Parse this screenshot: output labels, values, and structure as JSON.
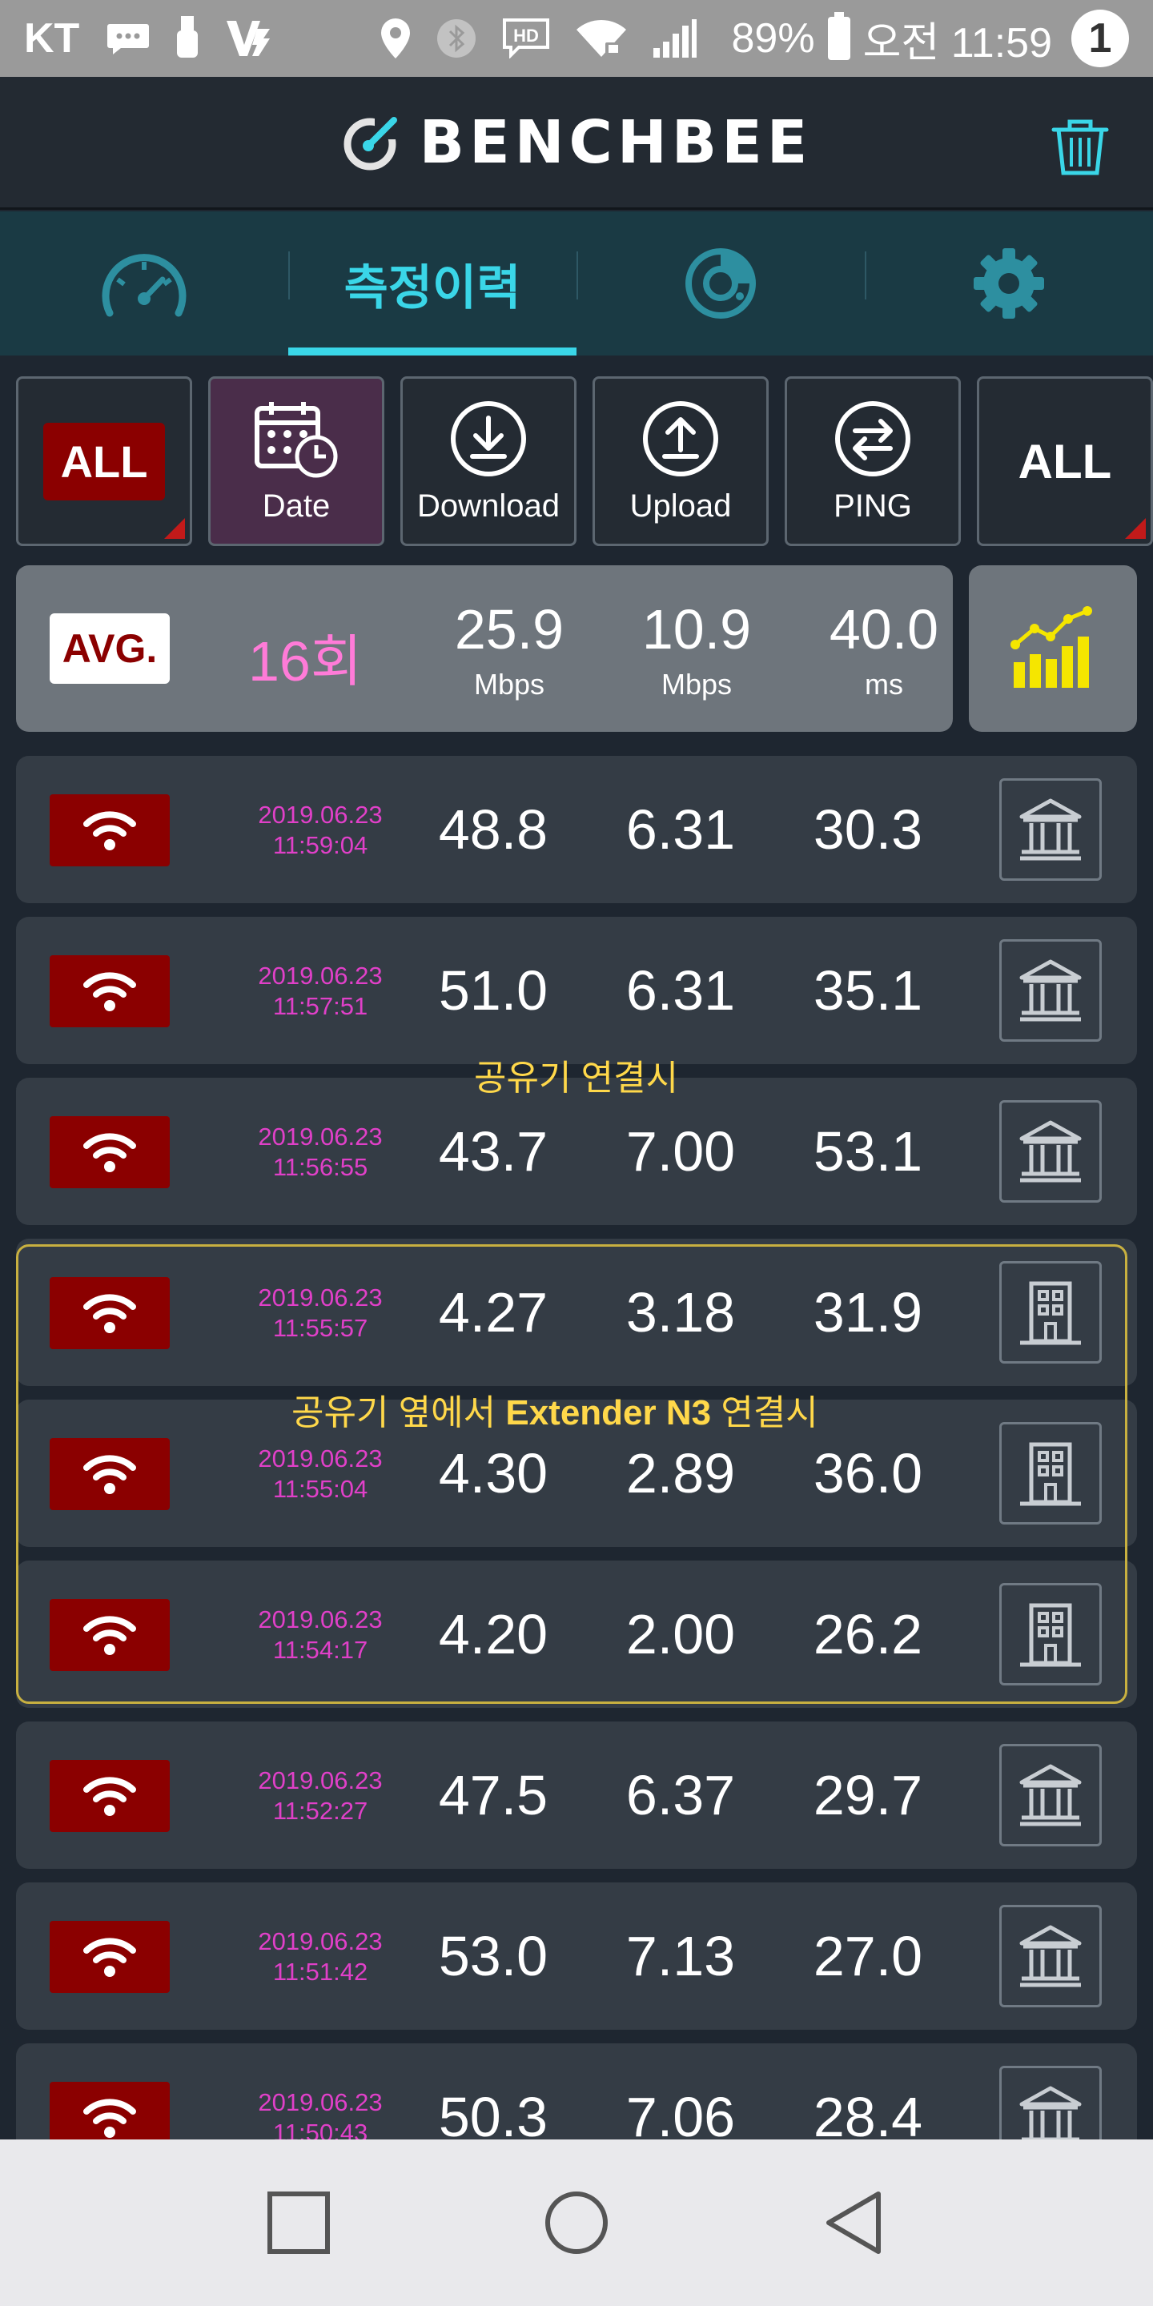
{
  "status_bar": {
    "carrier": "KT",
    "battery": "89%",
    "time": "오전 11:59",
    "notification_count": "1"
  },
  "header": {
    "app_name": "BENCHBEE"
  },
  "tabs": [
    {
      "label": "",
      "icon": "speedometer-icon"
    },
    {
      "label": "측정이력",
      "icon": ""
    },
    {
      "label": "",
      "icon": "chart-icon"
    },
    {
      "label": "",
      "icon": "gear-icon"
    }
  ],
  "filters": {
    "network": "ALL",
    "date": "Date",
    "download": "Download",
    "upload": "Upload",
    "ping": "PING",
    "server": "ALL"
  },
  "average": {
    "badge": "AVG.",
    "count": "16회",
    "download": "25.9",
    "download_unit": "Mbps",
    "upload": "10.9",
    "upload_unit": "Mbps",
    "ping": "40.0",
    "ping_unit": "ms"
  },
  "records": [
    {
      "date": "2019.06.23",
      "time": "11:59:04",
      "download": "48.8",
      "upload": "6.31",
      "ping": "30.3",
      "server_icon": "bank-icon"
    },
    {
      "date": "2019.06.23",
      "time": "11:57:51",
      "download": "51.0",
      "upload": "6.31",
      "ping": "35.1",
      "server_icon": "bank-icon"
    },
    {
      "date": "2019.06.23",
      "time": "11:56:55",
      "download": "43.7",
      "upload": "7.00",
      "ping": "53.1",
      "server_icon": "bank-icon"
    },
    {
      "date": "2019.06.23",
      "time": "11:55:57",
      "download": "4.27",
      "upload": "3.18",
      "ping": "31.9",
      "server_icon": "building-icon"
    },
    {
      "date": "2019.06.23",
      "time": "11:55:04",
      "download": "4.30",
      "upload": "2.89",
      "ping": "36.0",
      "server_icon": "building-icon"
    },
    {
      "date": "2019.06.23",
      "time": "11:54:17",
      "download": "4.20",
      "upload": "2.00",
      "ping": "26.2",
      "server_icon": "building-icon"
    },
    {
      "date": "2019.06.23",
      "time": "11:52:27",
      "download": "47.5",
      "upload": "6.37",
      "ping": "29.7",
      "server_icon": "bank-icon"
    },
    {
      "date": "2019.06.23",
      "time": "11:51:42",
      "download": "53.0",
      "upload": "7.13",
      "ping": "27.0",
      "server_icon": "bank-icon"
    },
    {
      "date": "2019.06.23",
      "time": "11:50:43",
      "download": "50.3",
      "upload": "7.06",
      "ping": "28.4",
      "server_icon": "bank-icon"
    }
  ],
  "annotations": {
    "router": "공유기 연결시",
    "extender_prefix": "공유기 옆에서 ",
    "extender_bold": "Extender N3",
    "extender_suffix": " 연결시"
  },
  "colors": {
    "accent": "#3ad6e8",
    "badge_red": "#8b0000",
    "timestamp": "#e040c8",
    "annotation": "#ffd84a"
  }
}
